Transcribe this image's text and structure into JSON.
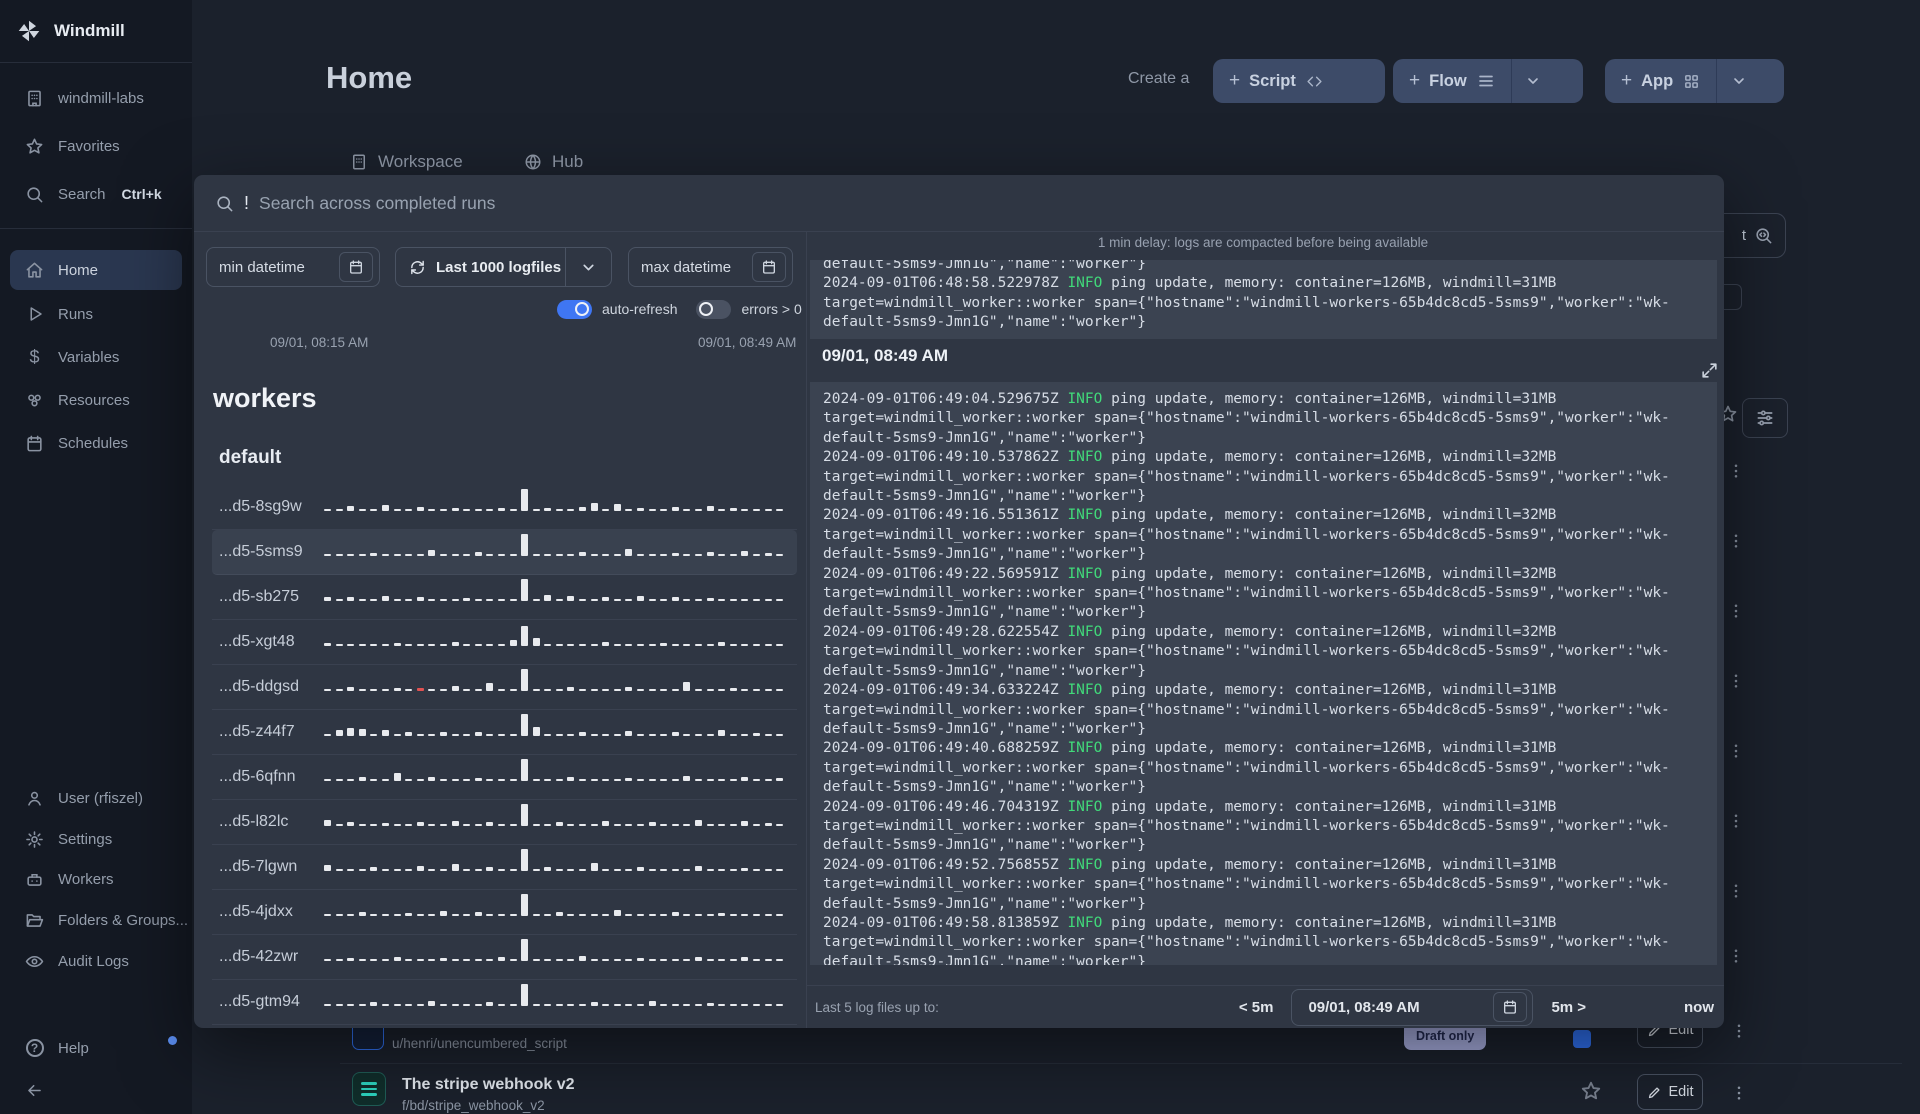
{
  "sidebar": {
    "brand": "Windmill",
    "workspace_item": "windmill-labs",
    "favorites": "Favorites",
    "search": "Search",
    "search_kbd": "Ctrl+k",
    "nav": [
      {
        "label": "Home"
      },
      {
        "label": "Runs"
      },
      {
        "label": "Variables"
      },
      {
        "label": "Resources"
      },
      {
        "label": "Schedules"
      }
    ],
    "bottom": [
      {
        "label": "User (rfiszel)"
      },
      {
        "label": "Settings"
      },
      {
        "label": "Workers"
      },
      {
        "label": "Folders & Groups..."
      },
      {
        "label": "Audit Logs"
      }
    ],
    "help": "Help"
  },
  "header": {
    "title": "Home",
    "create_prefix": "Create a",
    "script_label": "Script",
    "flow_label": "Flow",
    "app_label": "App",
    "plus": "+"
  },
  "tabs": {
    "workspace": "Workspace",
    "hub": "Hub"
  },
  "modal": {
    "search": {
      "typed": "!",
      "placeholder": "Search across completed runs"
    },
    "filters": {
      "min_datetime": "min datetime",
      "logfiles": "Last 1000 logfiles",
      "max_datetime": "max datetime",
      "auto_refresh_label": "auto-refresh",
      "errors_label": "errors > 0"
    },
    "range": {
      "start": "09/01, 08:15 AM",
      "end": "09/01, 08:49 AM"
    },
    "workers_section": {
      "heading": "workers",
      "group": "default"
    },
    "workers": [
      {
        "name": "...d5-8sg9w",
        "bars": [
          2,
          2,
          5,
          2,
          2,
          6,
          2,
          2,
          4,
          2,
          2,
          3,
          2,
          2,
          2,
          3,
          2,
          22,
          2,
          3,
          2,
          2,
          4,
          8,
          2,
          7,
          2,
          3,
          2,
          2,
          4,
          2,
          2,
          5,
          2,
          3,
          2,
          2,
          2,
          2
        ]
      },
      {
        "name": "...d5-5sms9",
        "selected": true,
        "bars": [
          2,
          2,
          2,
          2,
          3,
          2,
          2,
          2,
          2,
          6,
          2,
          2,
          2,
          4,
          2,
          2,
          2,
          22,
          2,
          2,
          2,
          2,
          4,
          2,
          2,
          2,
          7,
          2,
          2,
          2,
          3,
          2,
          2,
          4,
          2,
          2,
          5,
          2,
          3,
          2
        ]
      },
      {
        "name": "...d5-sb275",
        "bars": [
          4,
          2,
          4,
          2,
          2,
          5,
          2,
          2,
          4,
          2,
          2,
          2,
          3,
          2,
          2,
          2,
          2,
          22,
          2,
          6,
          2,
          5,
          2,
          2,
          4,
          2,
          2,
          5,
          2,
          2,
          4,
          2,
          2,
          3,
          2,
          2,
          2,
          2,
          2,
          2
        ]
      },
      {
        "name": "...d5-xgt48",
        "bars": [
          3,
          2,
          2,
          2,
          2,
          2,
          3,
          2,
          2,
          2,
          2,
          4,
          2,
          2,
          2,
          2,
          6,
          20,
          8,
          2,
          2,
          2,
          2,
          2,
          4,
          2,
          2,
          2,
          2,
          3,
          2,
          2,
          2,
          2,
          4,
          2,
          2,
          2,
          2,
          2
        ]
      },
      {
        "name": "...d5-ddgsd",
        "red": 8,
        "bars": [
          2,
          2,
          4,
          2,
          2,
          2,
          3,
          2,
          3,
          2,
          2,
          5,
          2,
          2,
          8,
          2,
          2,
          22,
          2,
          2,
          2,
          4,
          2,
          2,
          2,
          2,
          4,
          2,
          2,
          2,
          2,
          9,
          2,
          2,
          2,
          3,
          2,
          2,
          2,
          2
        ]
      },
      {
        "name": "...d5-z44f7",
        "bars": [
          2,
          6,
          8,
          7,
          2,
          6,
          2,
          4,
          2,
          2,
          4,
          2,
          2,
          4,
          2,
          2,
          2,
          22,
          9,
          2,
          2,
          2,
          4,
          2,
          2,
          2,
          5,
          2,
          2,
          2,
          4,
          2,
          2,
          2,
          6,
          2,
          2,
          3,
          2,
          2
        ]
      },
      {
        "name": "...d5-6qfnn",
        "bars": [
          2,
          2,
          2,
          4,
          2,
          2,
          8,
          2,
          2,
          4,
          2,
          2,
          2,
          3,
          2,
          2,
          2,
          22,
          2,
          2,
          2,
          4,
          2,
          2,
          2,
          2,
          3,
          2,
          2,
          2,
          2,
          5,
          2,
          2,
          2,
          2,
          4,
          2,
          2,
          3
        ]
      },
      {
        "name": "...d5-l82lc",
        "bars": [
          6,
          2,
          4,
          2,
          2,
          3,
          2,
          2,
          4,
          2,
          2,
          5,
          2,
          2,
          4,
          2,
          2,
          22,
          2,
          2,
          4,
          2,
          2,
          2,
          5,
          2,
          2,
          2,
          4,
          2,
          2,
          2,
          6,
          2,
          2,
          2,
          5,
          2,
          3,
          2
        ]
      },
      {
        "name": "...d5-7lgwn",
        "bars": [
          6,
          2,
          2,
          2,
          4,
          2,
          2,
          2,
          5,
          2,
          2,
          7,
          2,
          2,
          4,
          2,
          2,
          22,
          2,
          4,
          2,
          2,
          2,
          8,
          2,
          2,
          2,
          4,
          2,
          2,
          2,
          2,
          5,
          2,
          2,
          2,
          3,
          2,
          2,
          2
        ]
      },
      {
        "name": "...d5-4jdxx",
        "bars": [
          2,
          2,
          2,
          4,
          2,
          2,
          2,
          3,
          2,
          2,
          5,
          2,
          2,
          4,
          2,
          2,
          2,
          22,
          2,
          2,
          4,
          2,
          2,
          2,
          2,
          6,
          2,
          2,
          2,
          2,
          4,
          2,
          2,
          2,
          3,
          2,
          2,
          2,
          2,
          2
        ]
      },
      {
        "name": "...d5-42zwr",
        "bars": [
          2,
          2,
          3,
          2,
          2,
          2,
          4,
          2,
          2,
          2,
          3,
          2,
          2,
          2,
          2,
          4,
          2,
          22,
          2,
          2,
          2,
          2,
          5,
          2,
          2,
          2,
          2,
          3,
          2,
          2,
          2,
          2,
          4,
          2,
          2,
          2,
          4,
          2,
          2,
          2
        ]
      },
      {
        "name": "...d5-gtm94",
        "bars": [
          2,
          2,
          2,
          2,
          4,
          2,
          2,
          2,
          2,
          5,
          2,
          2,
          2,
          2,
          4,
          2,
          2,
          22,
          2,
          2,
          2,
          2,
          2,
          4,
          2,
          2,
          2,
          2,
          5,
          2,
          2,
          2,
          2,
          3,
          2,
          2,
          2,
          2,
          2,
          2
        ]
      }
    ],
    "logs": {
      "notice": "1 min delay: logs are compacted before being available",
      "clipped_line": "default-5sms9-Jmn1G\",\"name\":\"worker\"}",
      "section_label": "09/01, 08:49 AM",
      "info_label": "INFO",
      "msg_tail": " ping update, memory: container=126MB, windmill=",
      "wrap_line": "target=windmill_worker::worker span={\"hostname\":\"windmill-workers-65b4dc8cd5-5sms9\",\"worker\":\"wk-",
      "tail_line": "default-5sms9-Jmn1G\",\"name\":\"worker\"}",
      "top_entry": {
        "ts": "2024-09-01T06:48:58.522978Z",
        "windmill": "31MB"
      },
      "entries": [
        {
          "ts": "2024-09-01T06:49:04.529675Z",
          "windmill": "31MB"
        },
        {
          "ts": "2024-09-01T06:49:10.537862Z",
          "windmill": "32MB"
        },
        {
          "ts": "2024-09-01T06:49:16.551361Z",
          "windmill": "32MB"
        },
        {
          "ts": "2024-09-01T06:49:22.569591Z",
          "windmill": "32MB"
        },
        {
          "ts": "2024-09-01T06:49:28.622554Z",
          "windmill": "32MB"
        },
        {
          "ts": "2024-09-01T06:49:34.633224Z",
          "windmill": "31MB"
        },
        {
          "ts": "2024-09-01T06:49:40.688259Z",
          "windmill": "31MB"
        },
        {
          "ts": "2024-09-01T06:49:46.704319Z",
          "windmill": "31MB"
        },
        {
          "ts": "2024-09-01T06:49:52.756855Z",
          "windmill": "31MB"
        },
        {
          "ts": "2024-09-01T06:49:58.813859Z",
          "windmill": "31MB"
        }
      ]
    },
    "footer": {
      "label": "Last 5 log files up to:",
      "prev": "< 5m",
      "datetime": "09/01, 08:49 AM",
      "next": "5m >",
      "now_label": "now"
    }
  },
  "background": {
    "row1_path": "u/henri/unencumbered_script",
    "row1_badge": "Draft only",
    "row2_title": "The stripe webhook v2",
    "row2_path": "f/bd/stripe_webhook_v2",
    "edit_label": "Edit",
    "topright_fragment": "t"
  }
}
